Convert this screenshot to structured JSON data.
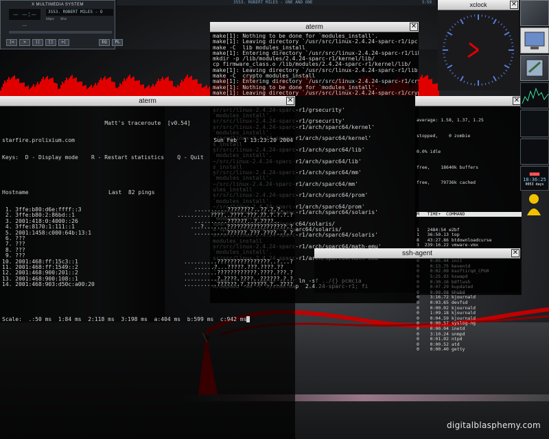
{
  "xmms": {
    "title": "X MULTIMEDIA SYSTEM",
    "song": "3553. ROBERT MILES - O",
    "kbps": "kbps",
    "khz": "khz",
    "eq": "EQ",
    "pl": "PL",
    "btn_prev": "|<",
    "btn_play": ">",
    "btn_pause": "||",
    "btn_stop": "[]",
    "btn_next": ">|"
  },
  "playlist_strip": "3553. ROBERT MILES - ONE AND ONE",
  "playlist_time": "3:59",
  "aterm_left": {
    "title": "aterm",
    "header": "Matt's traceroute  [v0.54]",
    "host": "starfire.prolixium.com",
    "date": "Sun Feb  1 13:23:20 2004",
    "keys": "Keys:  D - Display mode    R - Restart statistics    Q - Quit",
    "col_host": "Hostname",
    "col_last": "Last  82 pings",
    "rows": [
      {
        "n": " 1.",
        "host": "3ffe:b80:d6e:ffff::3",
        "pings": "..........????????..??.?.?."
      },
      {
        "n": " 2.",
        "host": "3ffe:b80:2:86bd::1",
        "pings": "..........????..????.???.??.?.?.?.?"
      },
      {
        "n": " 3.",
        "host": "2001:418:0:4000::26",
        "pings": "..........??????..?.????.."
      },
      {
        "n": " 4.",
        "host": "3ffe:8170:1:111::1",
        "pings": "...?.......??????????????????.?"
      },
      {
        "n": " 5.",
        "host": "2001:1458:c000:64b:13:1",
        "pings": "..........??????.???.????..?.?"
      },
      {
        "n": " 6.",
        "host": "???",
        "pings": ""
      },
      {
        "n": " 7.",
        "host": "???",
        "pings": ""
      },
      {
        "n": " 8.",
        "host": "???",
        "pings": ""
      },
      {
        "n": " 9.",
        "host": "???",
        "pings": ""
      },
      {
        "n": "10.",
        "host": "2001:468:ff:15c3::1",
        "pings": "..........????????????????..?...?"
      },
      {
        "n": "11.",
        "host": "2001:468:ff:1549::2",
        "pings": "......?...?????.???.????.??"
      },
      {
        "n": "12.",
        "host": "2001:468:900:201::2",
        "pings": "..........????????????.????.???.?"
      },
      {
        "n": "13.",
        "host": "2001:468:900:108::1",
        "pings": "..........?.????.????..??????.?.?"
      },
      {
        "n": "14.",
        "host": "2001:468:903:d50c:a00:20",
        "pings": "..........??????.?.??????.?..????"
      }
    ],
    "scale": "Scale:  .:50 ms  1:84 ms  2:118 ms  3:198 ms  a:404 ms  b:599 ms  c:942 ms"
  },
  "aterm_mid": {
    "title": "aterm",
    "lines": [
      "make[1]: Nothing to be done for `modules_install'.",
      "make[1]: Leaving directory `/usr/src/linux-2.4.24-sparc-r1/ipc'",
      "make -C  lib modules_install",
      "make[1]: Entering directory `/usr/src/linux-2.4.24-sparc-r1/lib'",
      "mkdir -p /lib/modules/2.4.24-sparc-r1/kernel/lib/",
      "cp firmware_class.o /lib/modules/2.4.24-sparc-r1/kernel/lib/",
      "make[1]: Leaving directory `/usr/src/linux-2.4.24-sparc-r1/lib'",
      "make -C  crypto modules_install",
      "make[1]: Entering directory `/usr/src/linux-2.4.24-sparc-r1/crypto'",
      "make[1]: Nothing to be done for `modules_install'.",
      "make[1]: Leaving directory `/usr/src/linux-2.4.24-sparc-r1/crypto'",
      "install",
      "`modules_install'.",
      "sr/src/linux-2.4.24-sparc-r1/grsecurity'",
      "`modules_install'.",
      "sr/src/linux-2.4.24-sparc-r1/grsecurity'",
      "sr/src/linux-2.4.24-sparc-r1/arch/sparc64/kernel'",
      "`modules_install'.",
      "~/src/linux-2.4.24-sparc-r1/arch/sparc64/kernel'",
      "s_install",
      "sr/src/linux-2.4.24-sparc-r1/arch/sparc64/lib'",
      "`modules_install'.",
      "~/src/linux-2.4.24-sparc-r1/arch/sparc64/lib'",
      "s_install",
      "sr/src/linux-2.4.24-sparc-r1/arch/sparc64/mm'",
      "`modules_install'.",
      "~/src/linux-2.4.24-sparc-r1/arch/sparc64/mm'",
      "ules_install",
      "sr/src/linux-2.4.24-sparc-r1/arch/sparc64/prom'",
      "`modules_install'.",
      "~/src/linux-2.4.24-sparc-r1/arch/sparc64/prom'",
      "sr/src/linux-2.4.24-sparc-r1/arch/sparc64/solaris'",
      "`modules_install'.",
      "sparc-r1/kernel/arch/sparc64/solaris/",
      "4-sparc-r1/kernel/arch/sparc64/solaris/",
      "sr/src/linux-2.4.24-sparc-r1/arch/sparc64/solaris'",
      "modules_install",
      "sr/src/linux-2.4.24-sparc-r1/arch/sparc64/math-emu'",
      "`modules_install'.",
      "sr/src/linux-2.4.24-sparc-r1/arch/sparc64/math-emu'",
      "",
      "\\",
      "",
      "-name '*.o' | xargs -i -r ln -sf ../{} pcmcia",
      "n/depmod -ae -F System.map  2.4.24-sparc-r1; fi"
    ]
  },
  "top": {
    "load": "average: 1.58, 1.37, 1.25",
    "stopped": "stopped,    0 zombie",
    "idle": "0.0% idle",
    "buffers": "free,    18640k buffers",
    "cached": "free,    79736k cached",
    "header": "M   TIME+  COMMAND",
    "procs": [
      "1   2484:54 e2bf",
      "1   36:50.13 top",
      "8   43:27.86 btdownloadcurse",
      "3  239:16.22 vmware-vmx",
      "9  168:31.37 XFree86",
      "1    0:36.11 aterm",
      "0    0:05.44 init",
      "0    0:13.75 keventd",
      "0    0:02.09 ksoftirqd_CPU0",
      "0    5:25.93 kswapd",
      "0    0:30.16 bdflush",
      "0    0:07.29 kupdated",
      "0    0:00.08 khubd",
      "0    3:16.72 kjournald",
      "0    0:03.65 devfsd",
      "0    0:00.02 kjournald",
      "0    1:09.18 kjournald",
      "0    0:04.59 kjournald",
      "0    0:00.57 syslog-ng",
      "0    0:00.04 inetd",
      "0    3:10.24 snmpd",
      "0    0:01.02 ntpd",
      "0    0:00.52 atd",
      "0    0:00.40 getty"
    ]
  },
  "ssh": {
    "title": "ssh-agent"
  },
  "xclock": {
    "title": "xclock"
  },
  "dock": {
    "clock_time": "18:36:25",
    "date": "0053 days"
  },
  "watermark": "digitalblasphemy.com",
  "colors": {
    "accent_red": "#d10000",
    "graph_red": "#e00000",
    "term_bg": "#000000"
  }
}
